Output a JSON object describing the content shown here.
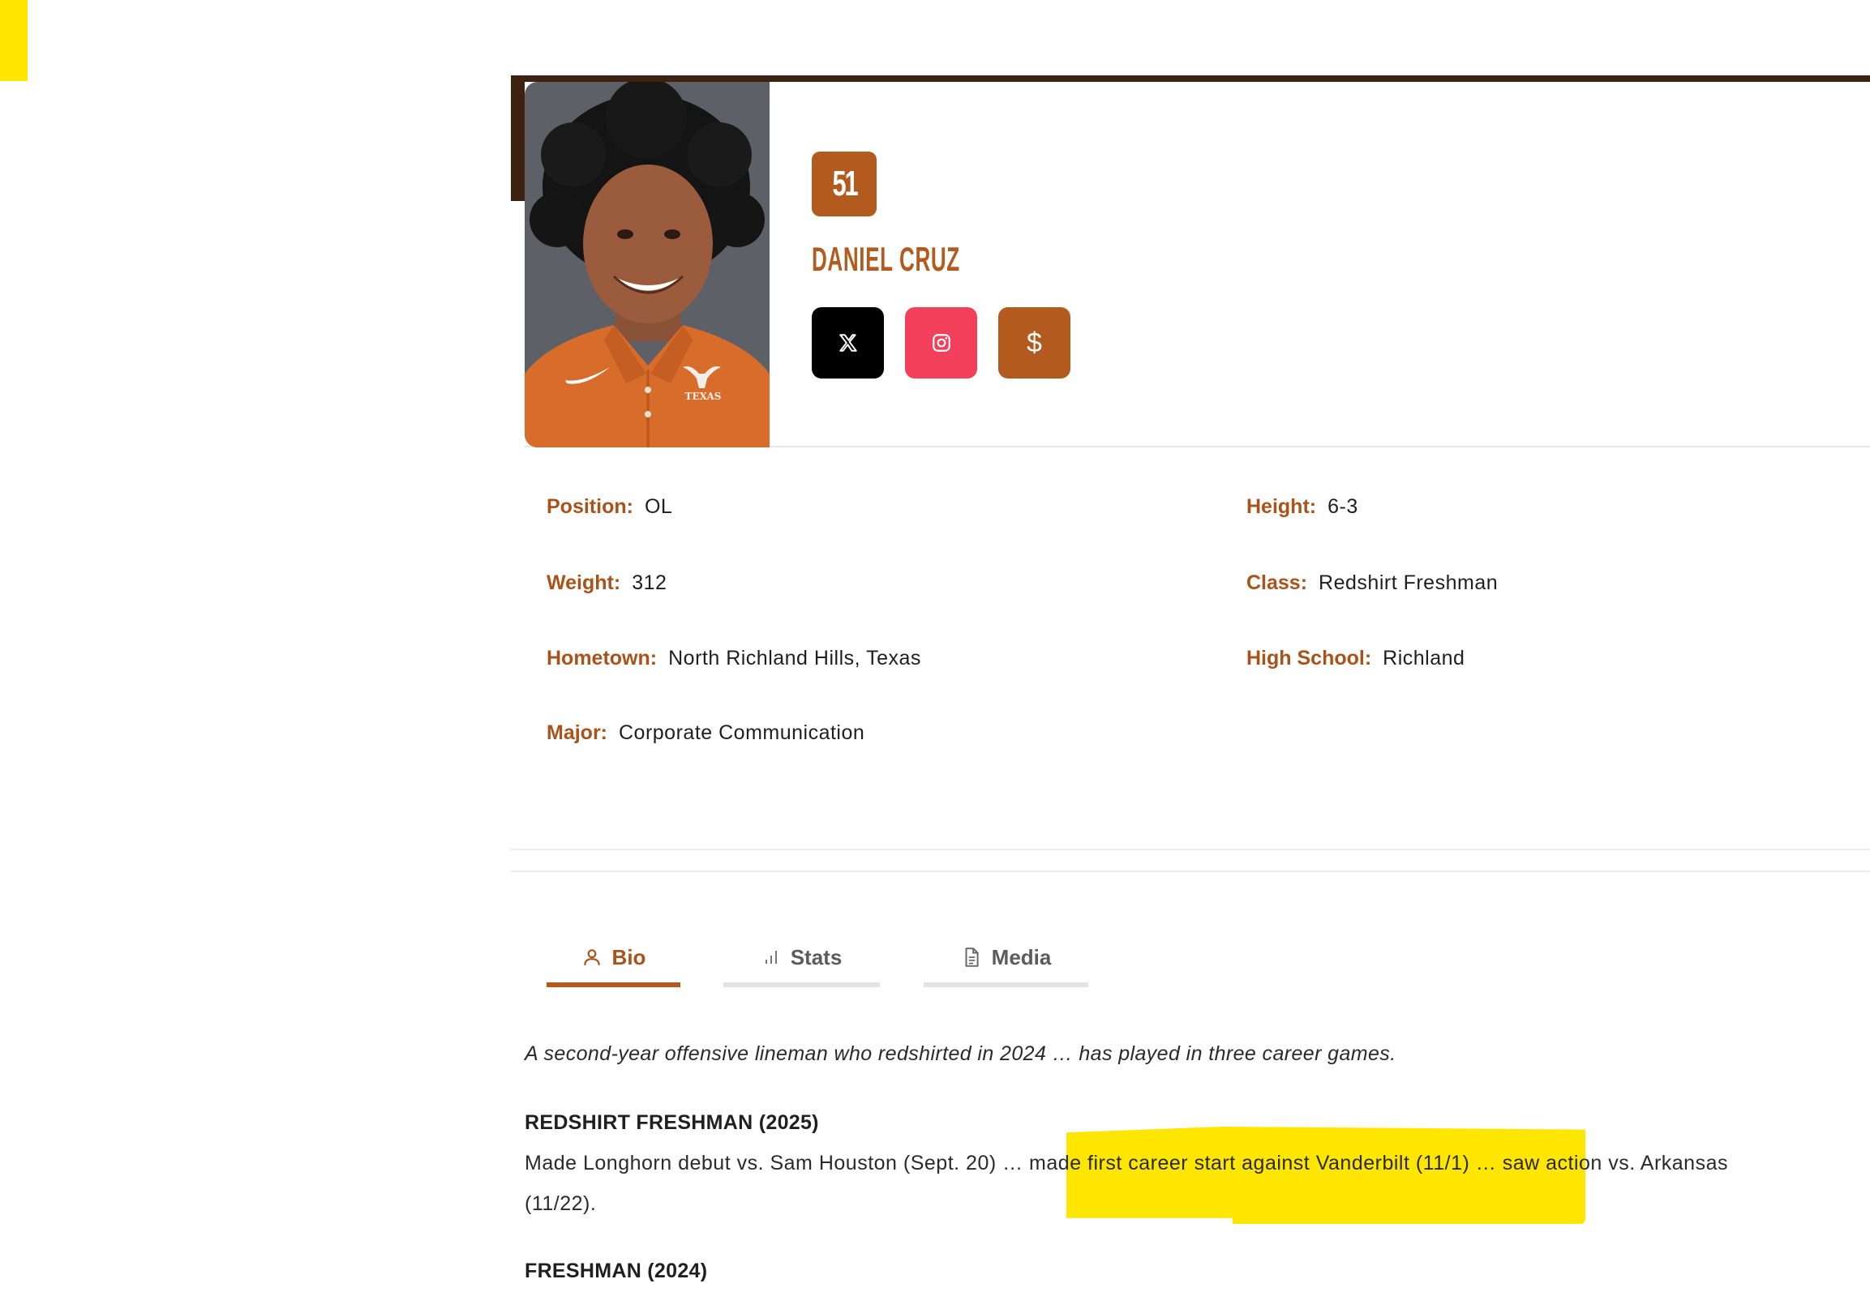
{
  "player": {
    "number": "51",
    "name": "DANIEL CRUZ"
  },
  "social": {
    "x_icon": "x-logo-icon",
    "instagram_icon": "instagram-icon",
    "nil_label": "$"
  },
  "info": {
    "position": {
      "label": "Position:",
      "value": "OL"
    },
    "height": {
      "label": "Height:",
      "value": "6-3"
    },
    "weight": {
      "label": "Weight:",
      "value": "312"
    },
    "class": {
      "label": "Class:",
      "value": "Redshirt Freshman"
    },
    "hometown": {
      "label": "Hometown:",
      "value": "North Richland Hills, Texas"
    },
    "high_school": {
      "label": "High School:",
      "value": "Richland"
    },
    "major": {
      "label": "Major:",
      "value": "Corporate Communication"
    }
  },
  "tabs": [
    {
      "label": "Bio",
      "icon": "person-icon",
      "active": true
    },
    {
      "label": "Stats",
      "icon": "bar-chart-icon",
      "active": false
    },
    {
      "label": "Media",
      "icon": "document-icon",
      "active": false
    }
  ],
  "bio": {
    "summary": "A second-year offensive lineman who redshirted in 2024 … has played in three career games.",
    "sections": [
      {
        "heading": "REDSHIRT FRESHMAN (2025)",
        "line1": "Made Longhorn debut vs. Sam Houston (Sept. 20) … made first career start against Vanderbilt (11/1) … saw action vs. Arkansas",
        "line2": "(11/22)."
      },
      {
        "heading": "FRESHMAN (2024)"
      }
    ]
  },
  "colors": {
    "accent": "#b35a1f",
    "hero_bar": "#3f2112",
    "instagram": "#f2405a",
    "highlight": "#ffe600"
  }
}
